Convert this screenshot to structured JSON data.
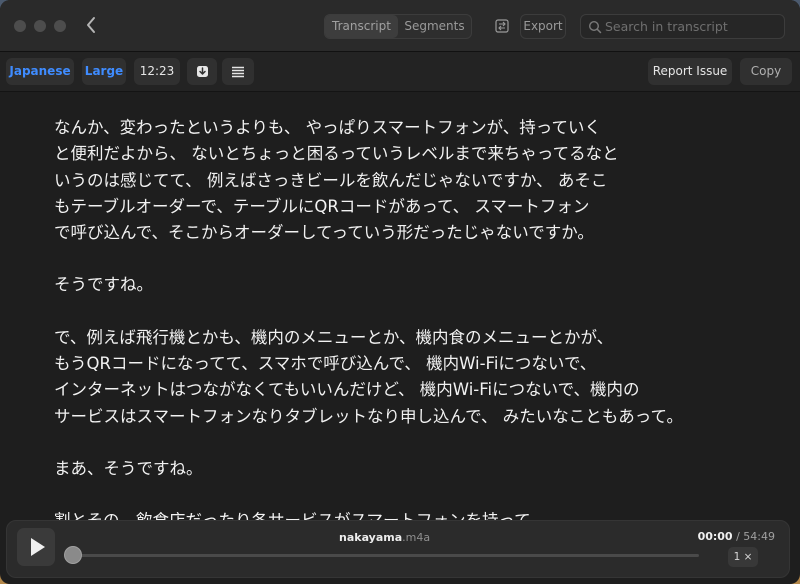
{
  "titlebar": {
    "tabs": [
      {
        "label": "Transcript",
        "active": true
      },
      {
        "label": "Segments",
        "active": false
      }
    ],
    "export_label": "Export",
    "search_placeholder": "Search in transcript"
  },
  "toolbar": {
    "language": "Japanese",
    "text_size": "Large",
    "timestamp": "12:23",
    "report_label": "Report Issue",
    "copy_label": "Copy"
  },
  "transcript": {
    "paragraphs": [
      {
        "lines": [
          "なんか、変わったというよりも、 やっぱりスマートフォンが、持っていく",
          "と便利だよから、 ないとちょっと困るっていうレベルまで来ちゃってるなと",
          "いうのは感じてて、 例えばさっきビールを飲んだじゃないですか、 あそこ",
          "もテーブルオーダーで、テーブルにQRコードがあって、 スマートフォン",
          "で呼び込んで、そこからオーダーしてっていう形だったじゃないですか。"
        ]
      },
      {
        "lines": [
          "そうですね。"
        ]
      },
      {
        "lines": [
          "で、例えば飛行機とかも、機内のメニューとか、機内食のメニューとかが、",
          "もうQRコードになってて、スマホで呼び込んで、 機内Wi-Fiにつないで、",
          "インターネットはつながなくてもいいんだけど、 機内Wi-Fiにつないで、機内の",
          "サービスはスマートフォンなりタブレットなり申し込んで、 みたいなこともあって。"
        ]
      },
      {
        "lines": [
          "まあ、そうですね。"
        ]
      },
      {
        "lines": [
          "割とその、飲食店だったり各サービスがスマートフォンを持って"
        ]
      }
    ]
  },
  "player": {
    "file_name": "nakayama",
    "file_ext": ".m4a",
    "current_time": "00:00",
    "separator": "/",
    "total_time": "54:49",
    "speed": "1 ×",
    "progress": 0
  },
  "icons": {
    "back": "chevron-left-icon",
    "segments_toggle": "swap-icon",
    "search": "search-icon",
    "download": "download-icon",
    "list": "list-icon",
    "play": "play-icon"
  },
  "colors": {
    "accent": "#3f8cff",
    "window_bg": "#1e1e1e",
    "text": "#f2f2f2"
  }
}
